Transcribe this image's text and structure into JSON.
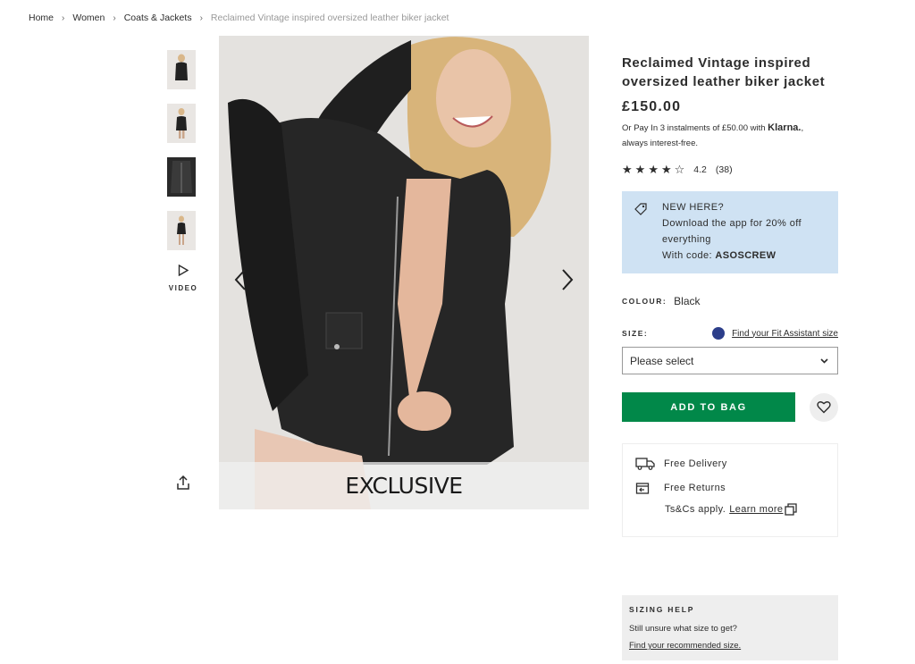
{
  "breadcrumb": {
    "items": [
      "Home",
      "Women",
      "Coats & Jackets"
    ],
    "current": "Reclaimed Vintage inspired oversized leather biker jacket"
  },
  "gallery": {
    "video_label": "VIDEO",
    "banner_text": "EXCLUSIVE",
    "thumbnail_count": 4
  },
  "product": {
    "title": "Reclaimed Vintage inspired oversized leather biker jacket",
    "price": "£150.00",
    "klarna_prefix": "Or Pay In 3 instalments of £50.00 with",
    "klarna_brand": "Klarna.",
    "klarna_suffix": "always interest-free.",
    "rating_value": "4.2",
    "rating_count": "(38)",
    "rating_stars": 4.2
  },
  "promo": {
    "heading": "NEW HERE?",
    "line1": "Download the app for 20% off everything",
    "code_prefix": "With code: ",
    "code": "ASOSCREW"
  },
  "colour": {
    "label": "COLOUR:",
    "value": "Black"
  },
  "size": {
    "label": "SIZE:",
    "fit_link": "Find your Fit Assistant size",
    "placeholder": "Please select"
  },
  "actions": {
    "add_to_bag": "ADD TO BAG"
  },
  "delivery": {
    "free_delivery": "Free Delivery",
    "free_returns": "Free Returns",
    "tcs": "Ts&Cs apply.",
    "learn_more": "Learn more"
  },
  "sizing_help": {
    "heading": "SIZING HELP",
    "text": "Still unsure what size to get?",
    "link": "Find your recommended size."
  },
  "colors": {
    "accent_green": "#018849",
    "promo_blue": "#cfe2f3",
    "text": "#2d2d2d"
  }
}
